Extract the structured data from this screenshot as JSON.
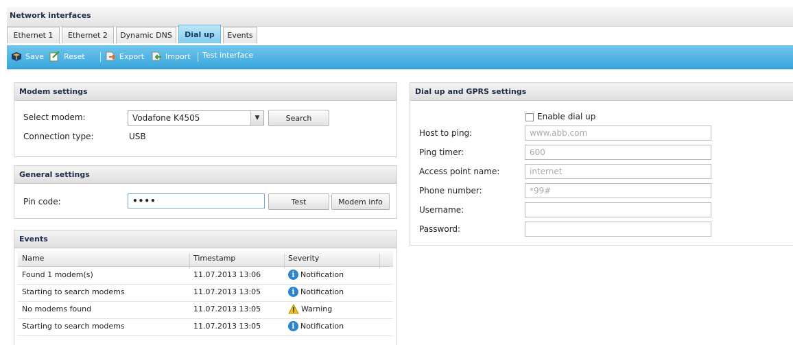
{
  "title": "Network interfaces",
  "tabs": [
    "Ethernet 1",
    "Ethernet 2",
    "Dynamic DNS",
    "Dial up",
    "Events"
  ],
  "toolbar": {
    "save": "Save",
    "reset": "Reset",
    "export": "Export",
    "import": "Import",
    "test_interface": "Test interface"
  },
  "modem": {
    "title": "Modem settings",
    "select_label": "Select modem:",
    "select_value": "Vodafone K4505",
    "search_button": "Search",
    "connection_label": "Connection type:",
    "connection_value": "USB"
  },
  "general": {
    "title": "General settings",
    "pin_label": "Pin code:",
    "pin_value": "••••",
    "test_button": "Test",
    "modem_info_button": "Modem info"
  },
  "events": {
    "title": "Events",
    "columns": [
      "Name",
      "Timestamp",
      "Severity"
    ],
    "rows": [
      {
        "name": "Found 1 modem(s)",
        "timestamp": "11.07.2013 13:06",
        "severity": "Notification",
        "icon": "info-icon"
      },
      {
        "name": "Starting to search modems",
        "timestamp": "11.07.2013 13:05",
        "severity": "Notification",
        "icon": "info-icon"
      },
      {
        "name": "No modems found",
        "timestamp": "11.07.2013 13:05",
        "severity": "Warning",
        "icon": "warning-icon"
      },
      {
        "name": "Starting to search modems",
        "timestamp": "11.07.2013 13:05",
        "severity": "Notification",
        "icon": "info-icon"
      }
    ]
  },
  "dialup": {
    "title": "Dial up and GPRS settings",
    "enable_label": "Enable dial up",
    "enable_checked": false,
    "host_label": "Host to ping:",
    "host_value": "www.abb.com",
    "ping_label": "Ping timer:",
    "ping_value": "600",
    "apn_label": "Access point name:",
    "apn_value": "internet",
    "phone_label": "Phone number:",
    "phone_value": "*99#",
    "username_label": "Username:",
    "username_value": "",
    "password_label": "Password:",
    "password_value": ""
  },
  "colors": {
    "toolbar": "#3aa6dc",
    "active_tab": "#7ecbee",
    "info": "#2b84cf",
    "warning": "#f2c21b"
  }
}
